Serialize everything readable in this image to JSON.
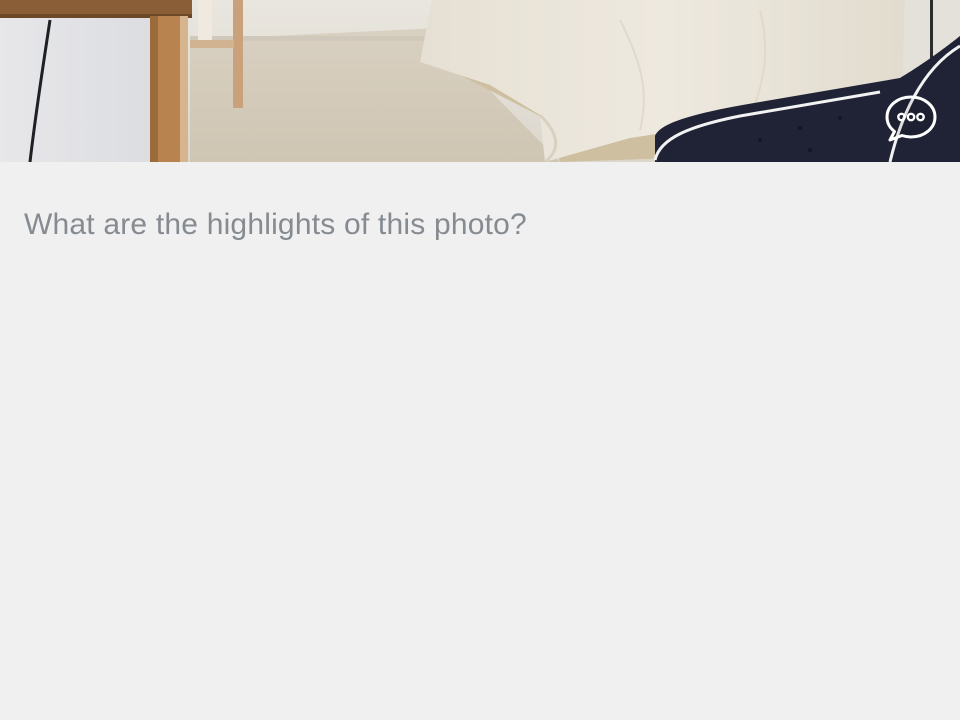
{
  "photo": {
    "alt_icon": "photo-bedroom-image"
  },
  "chat": {
    "icon": "chat-bubble-icon"
  },
  "prompt": {
    "text": "What are the highlights of this photo?"
  },
  "colors": {
    "background": "#f0f0f0",
    "prompt_text": "#858b91",
    "icon_stroke": "#ffffff"
  }
}
